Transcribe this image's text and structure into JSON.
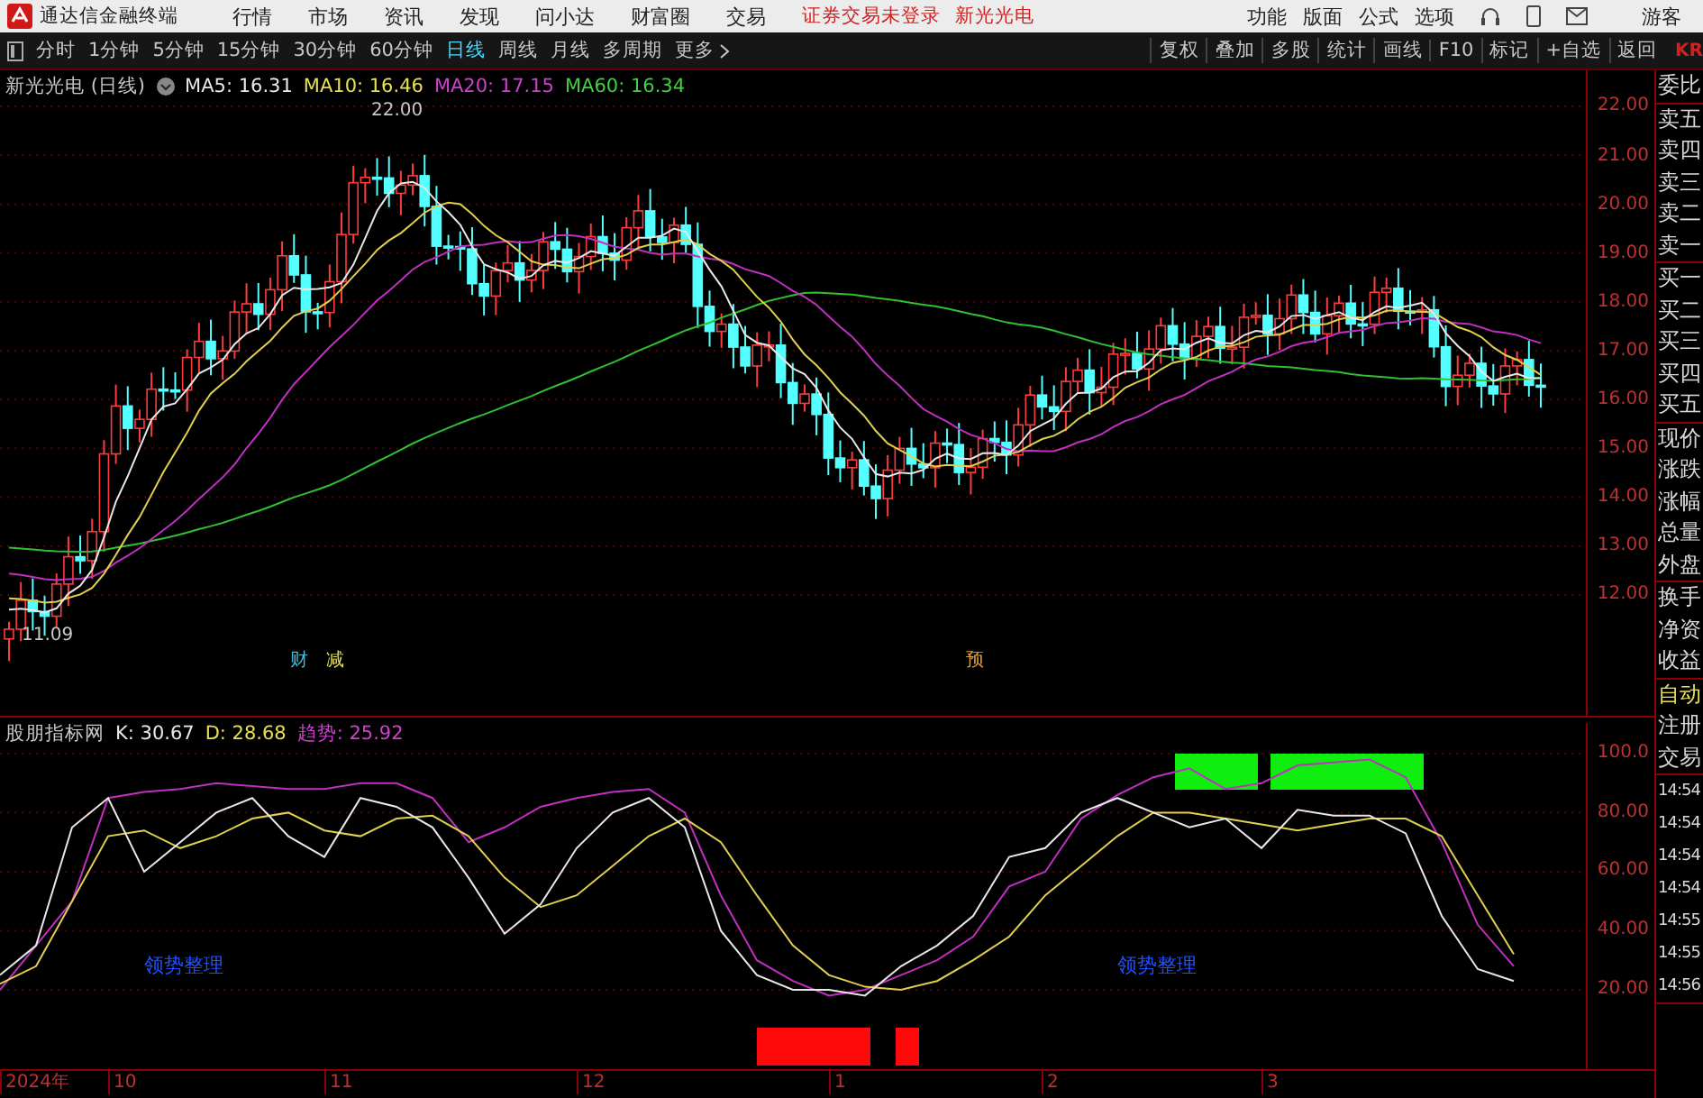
{
  "title_bar": {
    "app_name": "通达信金融终端",
    "menu": [
      "行情",
      "市场",
      "资讯",
      "发现",
      "问小达",
      "财富圈",
      "交易"
    ],
    "notices": [
      "证券交易未登录",
      "新光光电"
    ],
    "right_menu": [
      "功能",
      "版面",
      "公式",
      "选项"
    ],
    "user": "游客"
  },
  "toolbar": {
    "periods": [
      {
        "label": "分时",
        "selected": false
      },
      {
        "label": "1分钟",
        "selected": false
      },
      {
        "label": "5分钟",
        "selected": false
      },
      {
        "label": "15分钟",
        "selected": false
      },
      {
        "label": "30分钟",
        "selected": false
      },
      {
        "label": "60分钟",
        "selected": false
      },
      {
        "label": "日线",
        "selected": true
      },
      {
        "label": "周线",
        "selected": false
      },
      {
        "label": "月线",
        "selected": false
      },
      {
        "label": "多周期",
        "selected": false
      },
      {
        "label": "更多",
        "selected": false
      }
    ],
    "actions": [
      "复权",
      "叠加",
      "多股",
      "统计",
      "画线",
      "F10",
      "标记",
      "+自选",
      "返回"
    ],
    "edge_text": "KR"
  },
  "upper_chart": {
    "title": "新光光电 (日线)",
    "legend": [
      {
        "text": "MA5: 16.31",
        "color": "#e8e8e8"
      },
      {
        "text": "MA10: 16.46",
        "color": "#e8e050"
      },
      {
        "text": "MA20: 17.15",
        "color": "#d040d0"
      },
      {
        "text": "MA60: 16.34",
        "color": "#40d040"
      }
    ],
    "high_label": "22.00",
    "low_label": "11.09",
    "markers": [
      {
        "text": "财",
        "color": "#40c0e0"
      },
      {
        "text": "减",
        "color": "#e8e050"
      },
      {
        "text": "预",
        "color": "#e0a040"
      }
    ],
    "y_ticks": [
      "22.00",
      "21.00",
      "20.00",
      "19.00",
      "18.00",
      "17.00",
      "16.00",
      "15.00",
      "14.00",
      "13.00",
      "12.00"
    ]
  },
  "lower_chart": {
    "legend": [
      {
        "text": "股朋指标网",
        "color": "#c8c8c8"
      },
      {
        "text": "K: 30.67",
        "color": "#e8e8e8"
      },
      {
        "text": "D: 28.68",
        "color": "#e8e050"
      },
      {
        "text": "趋势: 25.92",
        "color": "#d040d0"
      }
    ],
    "signals": [
      "领势整理",
      "领势整理"
    ],
    "chart_data": {
      "type": "line",
      "grid": true,
      "ylim": [
        -6.9,
        100
      ],
      "yticks": [
        {
          "value": 100,
          "label": "100.0"
        },
        {
          "value": 80,
          "label": "80.00"
        },
        {
          "value": 60,
          "label": "60.00"
        },
        {
          "value": 40,
          "label": "40.00"
        },
        {
          "value": 20,
          "label": "20.00"
        }
      ],
      "series": [
        {
          "color": "#e8e8e8",
          "values": [
            25,
            35,
            75,
            85,
            60,
            70,
            80,
            85,
            72,
            65,
            85,
            82,
            75,
            58,
            39,
            49,
            68,
            80,
            85,
            75,
            40,
            25,
            20,
            20,
            18,
            28,
            35,
            45,
            65,
            68,
            80,
            85,
            80,
            75,
            78,
            68,
            81,
            79,
            79,
            73,
            45,
            27,
            23
          ]
        },
        {
          "color": "#e0d050",
          "values": [
            22,
            28,
            50,
            72,
            74,
            68,
            72,
            78,
            80,
            74,
            72,
            78,
            79,
            72,
            58,
            48,
            52,
            62,
            72,
            78,
            70,
            52,
            35,
            25,
            21,
            20,
            23,
            30,
            38,
            52,
            62,
            72,
            80,
            80,
            78,
            76,
            74,
            76,
            78,
            78,
            72,
            52,
            32
          ]
        },
        {
          "color": "#c030c0",
          "values": [
            20,
            35,
            50,
            85,
            87,
            88,
            90,
            89,
            88,
            88,
            90,
            90,
            85,
            70,
            75,
            82,
            85,
            87,
            88,
            80,
            52,
            30,
            23,
            18,
            20,
            25,
            30,
            38,
            55,
            60,
            78,
            86,
            92,
            95,
            88,
            90,
            96,
            97,
            98,
            92,
            70,
            42,
            28
          ]
        }
      ]
    }
  },
  "time_axis": [
    "2024年",
    "10",
    "11",
    "12",
    "1",
    "2",
    "3"
  ],
  "side_panel": {
    "groups": [
      {
        "items": [
          {
            "text": "委比",
            "kind": "label"
          }
        ]
      },
      {
        "items": [
          {
            "text": "卖五",
            "kind": "label"
          },
          {
            "text": "卖四",
            "kind": "label"
          },
          {
            "text": "卖三",
            "kind": "label"
          },
          {
            "text": "卖二",
            "kind": "label"
          },
          {
            "text": "卖一",
            "kind": "label"
          }
        ]
      },
      {
        "items": [
          {
            "text": "买一",
            "kind": "label"
          },
          {
            "text": "买二",
            "kind": "label"
          },
          {
            "text": "买三",
            "kind": "label"
          },
          {
            "text": "买四",
            "kind": "label"
          },
          {
            "text": "买五",
            "kind": "label"
          }
        ]
      },
      {
        "items": [
          {
            "text": "现价",
            "kind": "label"
          },
          {
            "text": "涨跌",
            "kind": "label"
          },
          {
            "text": "涨幅",
            "kind": "label"
          },
          {
            "text": "总量",
            "kind": "label"
          },
          {
            "text": "外盘",
            "kind": "label"
          }
        ]
      },
      {
        "items": [
          {
            "text": "换手",
            "kind": "label"
          },
          {
            "text": "净资",
            "kind": "label"
          },
          {
            "text": "收益",
            "kind": "label"
          }
        ]
      },
      {
        "items": [
          {
            "text": "自动",
            "kind": "mode"
          },
          {
            "text": "注册",
            "kind": "label"
          },
          {
            "text": "交易",
            "kind": "label"
          }
        ]
      },
      {
        "items": [
          {
            "text": "14:54",
            "kind": "time"
          },
          {
            "text": "14:54",
            "kind": "time"
          },
          {
            "text": "14:54",
            "kind": "time"
          },
          {
            "text": "14:54",
            "kind": "time"
          },
          {
            "text": "14:55",
            "kind": "time"
          },
          {
            "text": "14:55",
            "kind": "time"
          },
          {
            "text": "14:56",
            "kind": "time"
          }
        ]
      }
    ]
  }
}
